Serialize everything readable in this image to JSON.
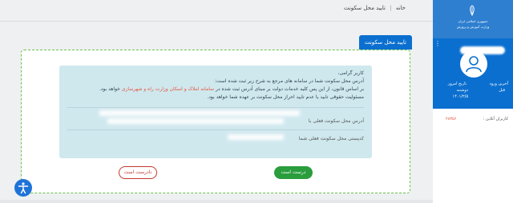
{
  "breadcrumb": {
    "home": "خانه",
    "separator": "|",
    "current": "تایید محل سکونت"
  },
  "sidebar": {
    "logo": {
      "line1": "جمهوری اسلامی ایران",
      "line2": "وزارت آموزش و پرورش"
    },
    "menu_icon": "⋮",
    "user": {
      "last_login_label": "آخرین ورود",
      "last_login_value": "قبل",
      "today_label": "تاریخ امروز",
      "today_value": "۱۴۰۱/۲/۵",
      "weekday": "دوشنبه"
    },
    "online": {
      "label": "کاربران آنلاین :",
      "count": "۲۸۳۵۶"
    }
  },
  "card": {
    "tab_title": "تایید محل سکونت",
    "greeting": "کاربر گرامی،",
    "line1": "آدرس محل سکونت شما در سامانه های مرجع به شرح زیر ثبت شده است:",
    "line2_part1": "بر اساس قانون، از این پس کلیه خدمات دولت بر مبنای آدرس ثبت شده در",
    "line2_highlight": "سامانه املاک و اسکان وزارت راه و شهرسازی",
    "line2_part2": "خواهد بود.",
    "line3": "مسئولیت حقوقی تایید یا عدم تایید احراز محل سکونت بر عهده شما خواهد بود.",
    "address_label": "آدرس محل سکونت فعلی با",
    "postal_label": "کدپستی محل سکونت فعلی شما"
  },
  "buttons": {
    "confirm": "درست است",
    "reject": "نادرست است"
  },
  "colors": {
    "primary": "#0b6fcf",
    "confirm": "#2a9d3c",
    "reject": "#c0392b",
    "dashed_border": "#6cc04a",
    "info_bg": "#cfe8ee"
  },
  "icons": {
    "accessibility": "accessibility-icon",
    "user": "user-icon",
    "emblem": "emblem-icon",
    "menu": "menu-icon"
  }
}
